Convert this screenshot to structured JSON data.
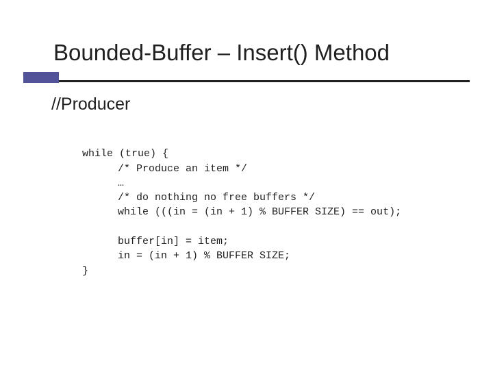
{
  "title": "Bounded-Buffer – Insert() Method",
  "subtitle": "//Producer",
  "code": {
    "l1": "while (true) {",
    "l2": "/* Produce an item */",
    "l3": "…",
    "l4": "/* do nothing no free buffers */",
    "l5": "while (((in = (in + 1) % BUFFER SIZE) == out);",
    "l6": "",
    "l7": "buffer[in] = item;",
    "l8": "in = (in + 1) % BUFFER SIZE;",
    "l9": "}"
  }
}
